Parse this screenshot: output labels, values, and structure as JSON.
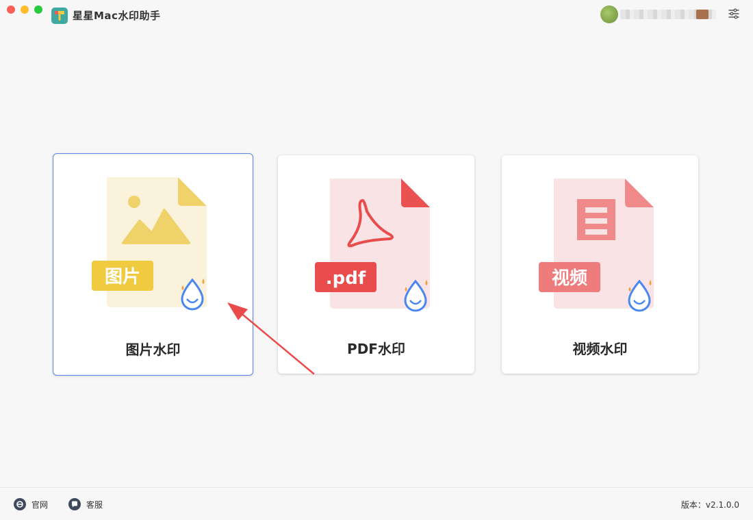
{
  "app": {
    "title": "星星Mac水印助手"
  },
  "cards": [
    {
      "label": "图片水印",
      "badge": "图片",
      "selected": true
    },
    {
      "label": "PDF水印",
      "badge": ".pdf",
      "selected": false
    },
    {
      "label": "视频水印",
      "badge": "视频",
      "selected": false
    }
  ],
  "footer": {
    "site_label": "官网",
    "service_label": "客服",
    "version_label": "版本：v2.1.0.0"
  },
  "colors": {
    "selected_border": "#5b84e8",
    "image_accent": "#f0cd5a",
    "pdf_accent": "#e84c4c",
    "video_accent": "#ee7c7c",
    "drop_icon": "#4a86ef"
  },
  "icons": {
    "settings": "sliders-icon",
    "site": "browser-icon",
    "service": "chat-bubble-icon"
  }
}
